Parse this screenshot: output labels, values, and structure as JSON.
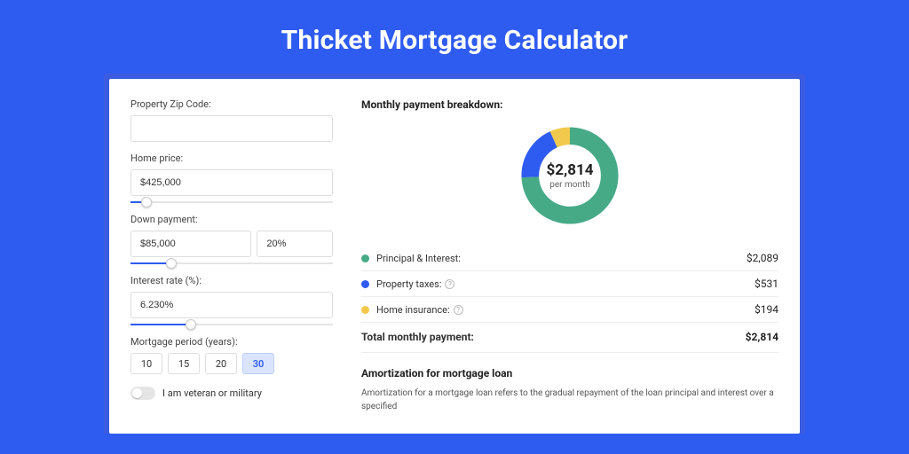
{
  "title": "Thicket Mortgage Calculator",
  "form": {
    "zip_label": "Property Zip Code:",
    "zip_value": "",
    "home_price_label": "Home price:",
    "home_price_value": "$425,000",
    "home_price_slider_pct": 8,
    "down_payment_label": "Down payment:",
    "down_payment_value": "$85,000",
    "down_payment_pct_value": "20%",
    "down_payment_slider_pct": 20,
    "interest_label": "Interest rate (%):",
    "interest_value": "6.230%",
    "interest_slider_pct": 30,
    "period_label": "Mortgage period (years):",
    "periods": [
      "10",
      "15",
      "20",
      "30"
    ],
    "period_selected_index": 3,
    "veteran_label": "I am veteran or military"
  },
  "breakdown": {
    "title": "Monthly payment breakdown:",
    "center_amount": "$2,814",
    "center_sub": "per month",
    "items": [
      {
        "label": "Principal & Interest:",
        "value": "$2,089",
        "color": "#46aa87",
        "help": false
      },
      {
        "label": "Property taxes:",
        "value": "$531",
        "color": "#2e5bf0",
        "help": true
      },
      {
        "label": "Home insurance:",
        "value": "$194",
        "color": "#f2c94c",
        "help": true
      }
    ],
    "total_label": "Total monthly payment:",
    "total_value": "$2,814"
  },
  "amortization": {
    "title": "Amortization for mortgage loan",
    "text": "Amortization for a mortgage loan refers to the gradual repayment of the loan principal and interest over a specified"
  },
  "chart_data": {
    "type": "pie",
    "title": "Monthly payment breakdown",
    "series": [
      {
        "name": "Principal & Interest",
        "value": 2089,
        "color": "#46aa87"
      },
      {
        "name": "Property taxes",
        "value": 531,
        "color": "#2e5bf0"
      },
      {
        "name": "Home insurance",
        "value": 194,
        "color": "#f2c94c"
      }
    ],
    "total": 2814,
    "center_label": "$2,814 per month"
  }
}
